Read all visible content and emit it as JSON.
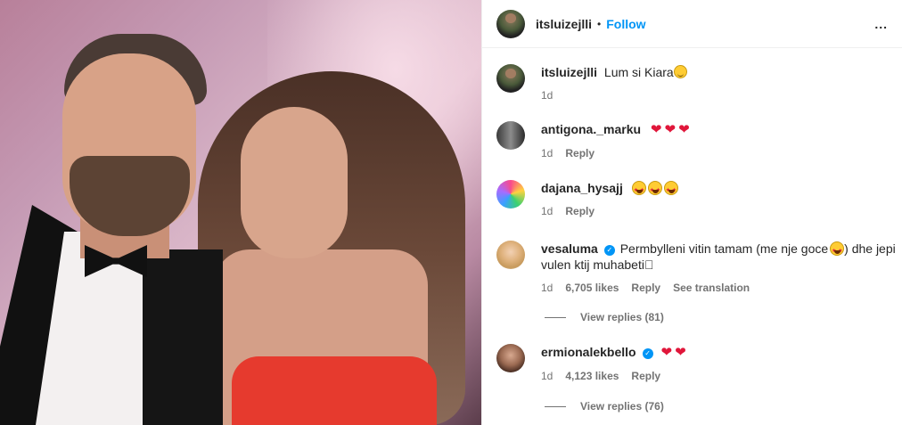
{
  "post": {
    "owner": {
      "username": "itsluizejlli",
      "follow_label": "Follow",
      "dot": "•",
      "more_label": "..."
    },
    "caption": {
      "username": "itsluizejlli",
      "text": "Lum si Kiara",
      "emoji": "smiling-face-icon",
      "time": "1d"
    }
  },
  "comments": [
    {
      "username": "antigona._marku",
      "text": "",
      "emojis": [
        "❤",
        "❤",
        "❤"
      ],
      "time": "1d",
      "reply_label": "Reply"
    },
    {
      "username": "dajana_hysajj",
      "text": "",
      "emojis": [
        "star-struck-face-icon",
        "star-struck-face-icon",
        "star-struck-face-icon"
      ],
      "time": "1d",
      "reply_label": "Reply"
    },
    {
      "username": "vesaluma",
      "verified": true,
      "text_part1": "Permbylleni vitin tamam (me nje goce",
      "text_part2": ") dhe jepi",
      "text_line2": "vulen ktij muhabeti",
      "trailing_glyph": "⃞",
      "time": "1d",
      "likes": "6,705 likes",
      "reply_label": "Reply",
      "translation_label": "See translation",
      "view_replies": "View replies (81)"
    },
    {
      "username": "ermionalekbello",
      "verified": true,
      "emojis": [
        "❤",
        "❤"
      ],
      "time": "1d",
      "likes": "4,123 likes",
      "reply_label": "Reply",
      "view_replies": "View replies (76)"
    }
  ],
  "colors": {
    "link_blue": "#0095f6",
    "muted": "#737373",
    "text": "#262626",
    "heart": "#e0163a"
  }
}
